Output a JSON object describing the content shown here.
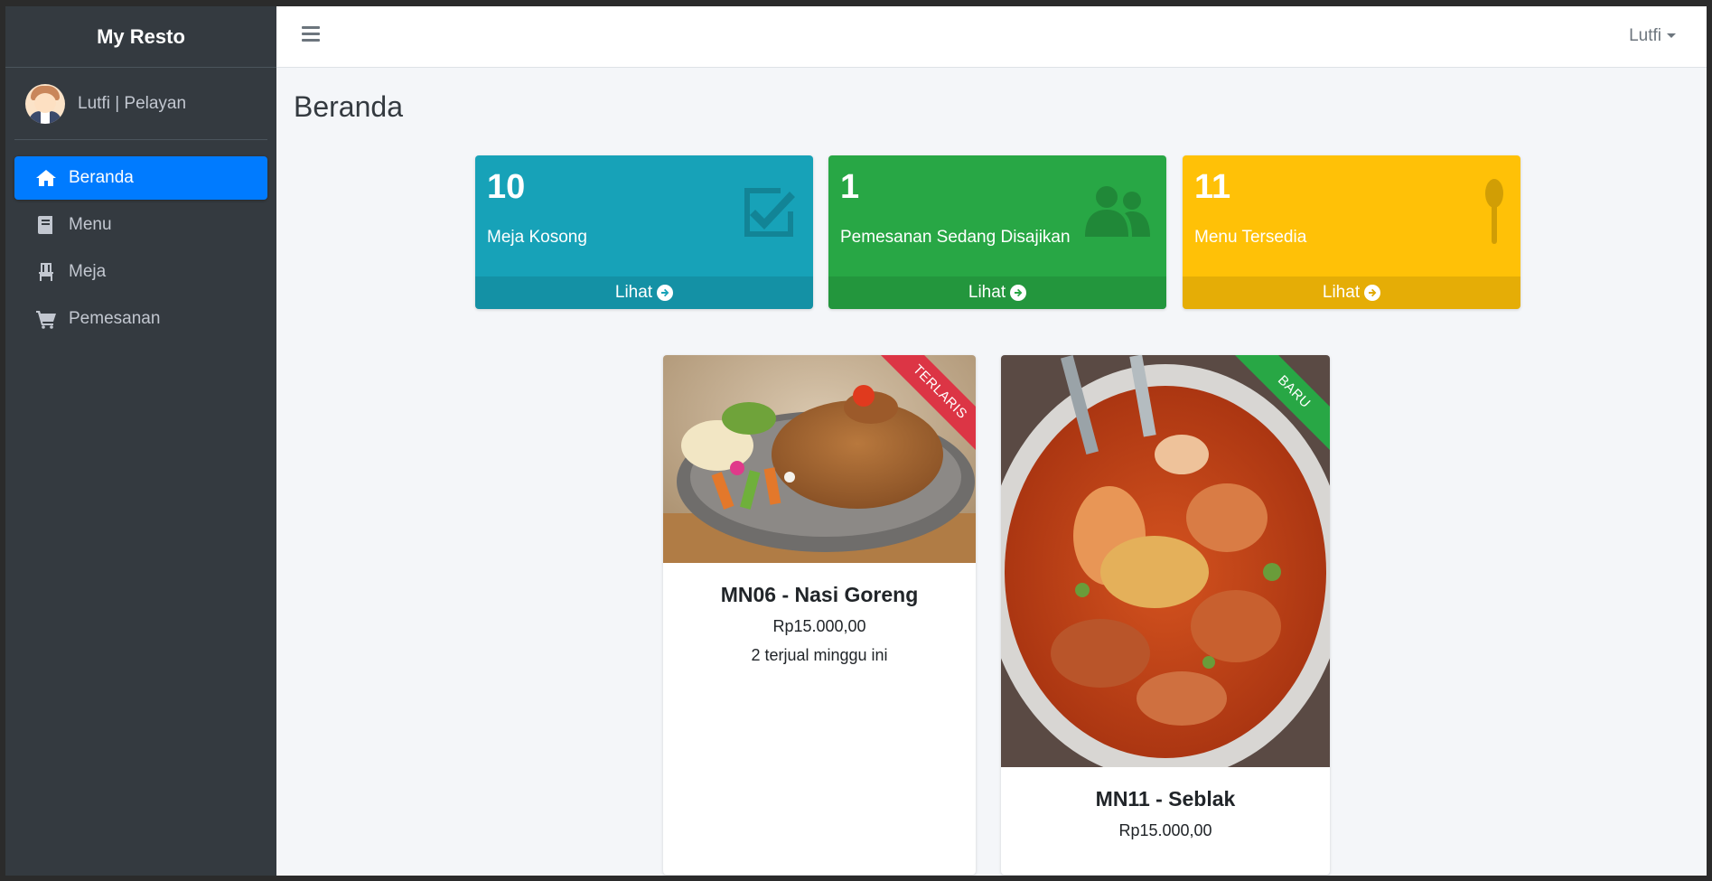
{
  "app": {
    "brand": "My Resto"
  },
  "user": {
    "panel_name": "Lutfi | Pelayan",
    "menu_name": "Lutfi"
  },
  "sidebar": {
    "items": [
      {
        "label": "Beranda",
        "icon": "home-icon",
        "active": true
      },
      {
        "label": "Menu",
        "icon": "book-icon",
        "active": false
      },
      {
        "label": "Meja",
        "icon": "chair-icon",
        "active": false
      },
      {
        "label": "Pemesanan",
        "icon": "cart-icon",
        "active": false
      }
    ]
  },
  "page": {
    "title": "Beranda"
  },
  "stats": [
    {
      "value": "10",
      "label": "Meja Kosong",
      "link": "Lihat",
      "color": "#17a2b8",
      "icon": "check-square-icon"
    },
    {
      "value": "1",
      "label": "Pemesanan Sedang Disajikan",
      "link": "Lihat",
      "color": "#28a745",
      "icon": "users-icon"
    },
    {
      "value": "11",
      "label": "Menu Tersedia",
      "link": "Lihat",
      "color": "#ffc107",
      "icon": "spoon-icon"
    }
  ],
  "menu_cards": [
    {
      "title": "MN06 - Nasi Goreng",
      "price": "Rp15.000,00",
      "sold": "2 terjual minggu ini",
      "ribbon": "TERLARIS",
      "ribbon_color": "#dc3545"
    },
    {
      "title": "MN11 - Seblak",
      "price": "Rp15.000,00",
      "ribbon": "BARU",
      "ribbon_color": "#28a745"
    }
  ]
}
